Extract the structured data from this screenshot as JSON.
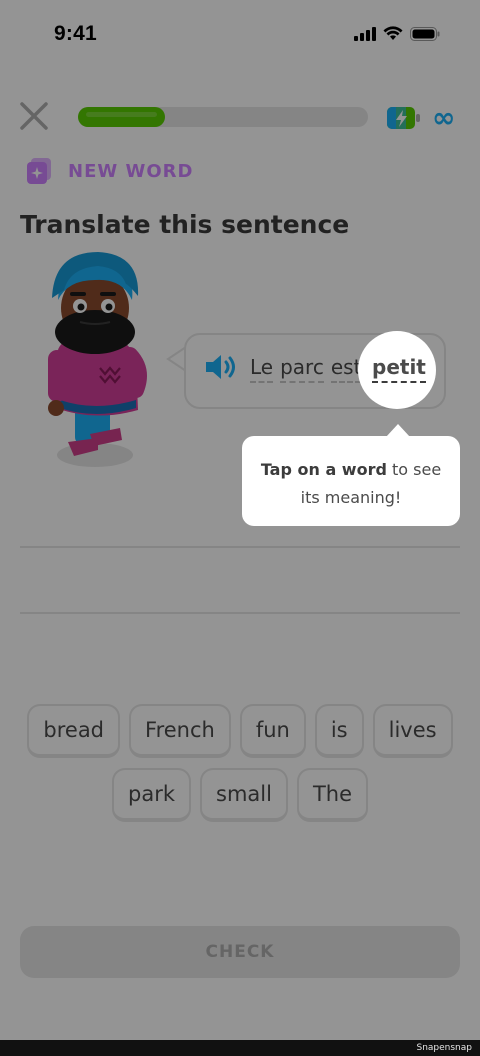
{
  "status_bar": {
    "time": "9:41"
  },
  "header": {
    "progress": 0.3,
    "infinity": "∞"
  },
  "lesson": {
    "badge": "NEW WORD",
    "title": "Translate this sentence",
    "sentence_words": [
      "Le",
      "parc",
      "est",
      "petit"
    ],
    "sentence_end": "."
  },
  "tooltip": {
    "bold": "Tap on a word",
    "rest": " to see",
    "line2": "its meaning!"
  },
  "word_bank": {
    "row1": [
      "bread",
      "French",
      "fun",
      "is",
      "lives"
    ],
    "row2": [
      "park",
      "small",
      "The"
    ]
  },
  "check_label": "CHECK",
  "watermark": "Snapensnap",
  "colors": {
    "green": "#58cc02",
    "purple": "#ce82ff",
    "blue": "#1cb0f6"
  }
}
